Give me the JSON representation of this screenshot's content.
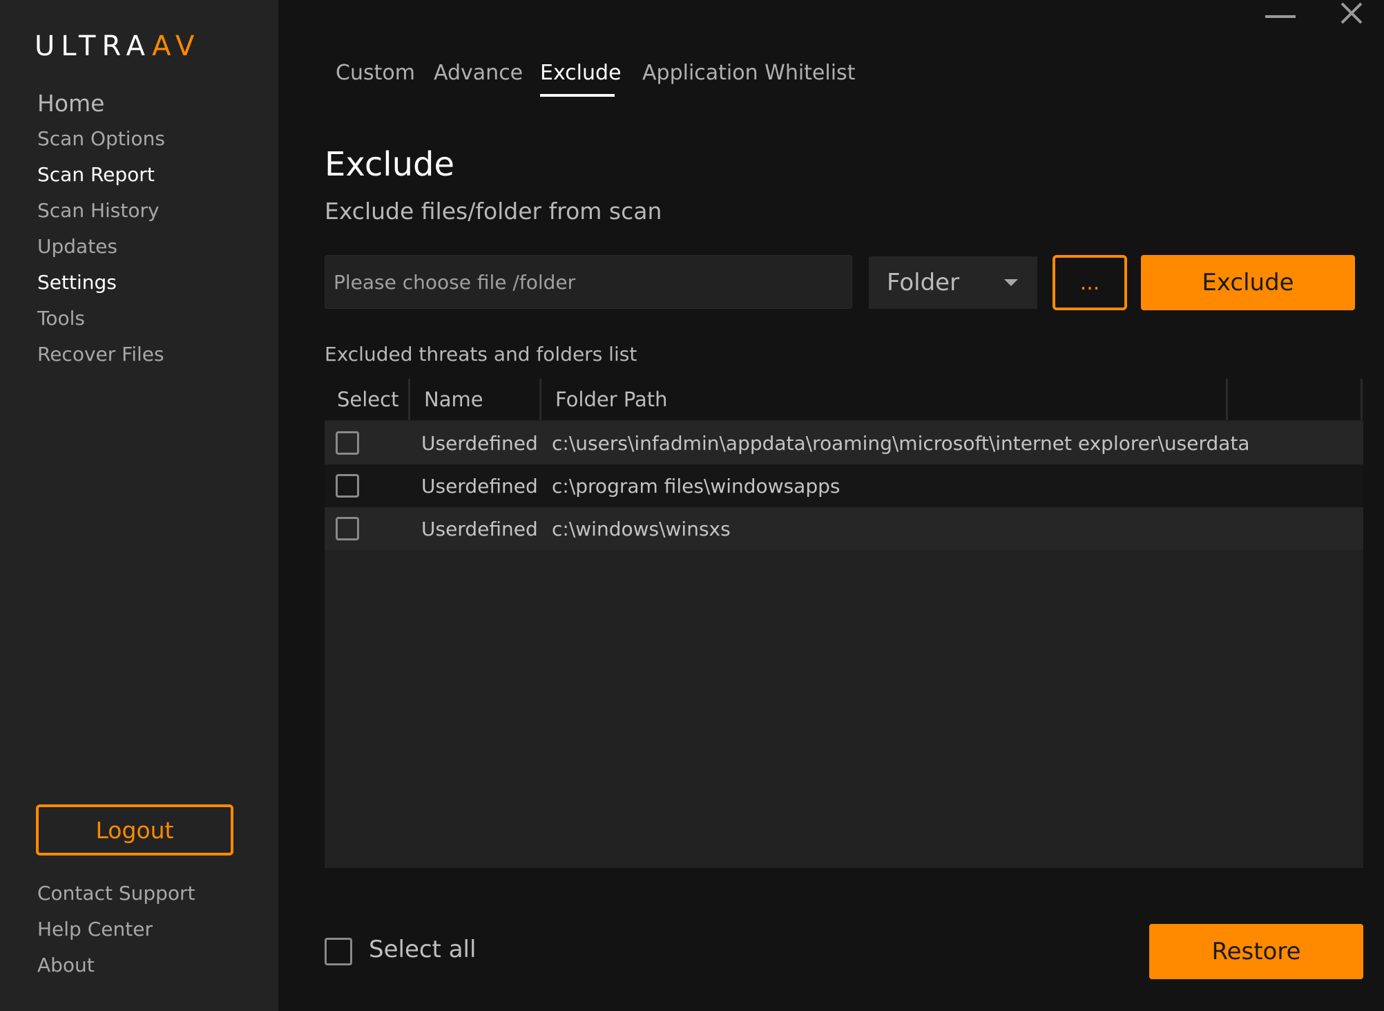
{
  "app": {
    "logo_text_main": "ULTRA",
    "logo_text_accent": "AV",
    "accent_color": "#ff8a00"
  },
  "window_controls": {
    "minimize_icon": "minimize-icon",
    "close_icon": "close-icon"
  },
  "sidebar": {
    "items": [
      {
        "label": "Home"
      },
      {
        "label": "Scan Options"
      },
      {
        "label": "Scan Report"
      },
      {
        "label": "Scan History"
      },
      {
        "label": "Updates"
      },
      {
        "label": "Settings"
      },
      {
        "label": "Tools"
      },
      {
        "label": "Recover Files"
      }
    ],
    "logout_label": "Logout",
    "footer_links": [
      {
        "label": "Contact Support"
      },
      {
        "label": "Help Center"
      },
      {
        "label": "About"
      }
    ]
  },
  "tabs": [
    {
      "label": "Custom"
    },
    {
      "label": "Advance"
    },
    {
      "label": "Exclude",
      "active": true
    },
    {
      "label": "Application Whitelist"
    }
  ],
  "main": {
    "title": "Exclude",
    "subtitle": "Exclude files/folder from scan",
    "path_input": {
      "value": "",
      "placeholder": "Please choose file /folder"
    },
    "type_select": {
      "selected": "Folder"
    },
    "browse_label": "...",
    "exclude_label": "Exclude",
    "list_caption": "Excluded threats and folders list",
    "table": {
      "columns": [
        "Select",
        "Name",
        "Folder Path"
      ],
      "rows": [
        {
          "checked": false,
          "name": "Userdefined",
          "path": "c:\\users\\infadmin\\appdata\\roaming\\microsoft\\internet explorer\\userdata"
        },
        {
          "checked": false,
          "name": "Userdefined",
          "path": "c:\\program files\\windowsapps"
        },
        {
          "checked": false,
          "name": "Userdefined",
          "path": "c:\\windows\\winsxs"
        }
      ]
    },
    "select_all_label": "Select all",
    "restore_label": "Restore"
  }
}
